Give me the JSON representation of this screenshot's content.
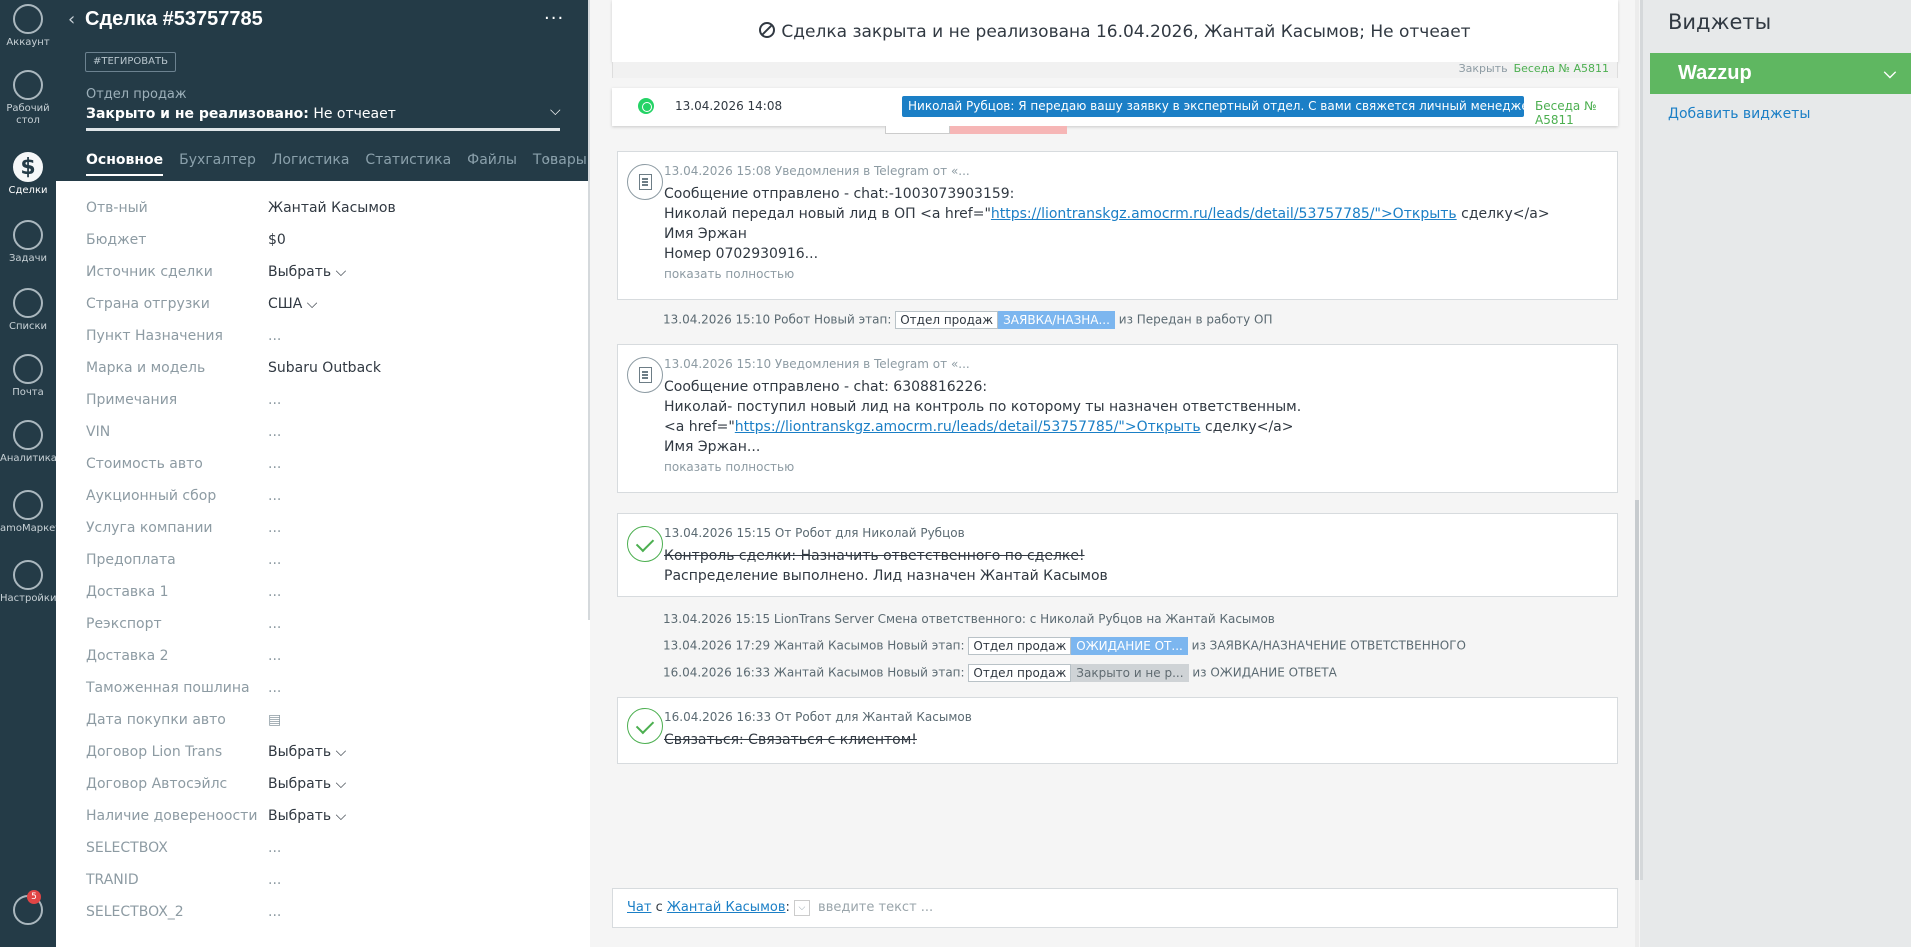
{
  "nav": {
    "items": [
      {
        "label": "Аккаунт",
        "icon": "account-icon"
      },
      {
        "label": "Рабочий стол",
        "icon": "dashboard-icon"
      },
      {
        "label": "Сделки",
        "icon": "deals-icon"
      },
      {
        "label": "Задачи",
        "icon": "tasks-icon"
      },
      {
        "label": "Списки",
        "icon": "lists-icon"
      },
      {
        "label": "Почта",
        "icon": "mail-icon"
      },
      {
        "label": "Аналитика",
        "icon": "analytics-icon"
      },
      {
        "label": "amoМаркет",
        "icon": "market-icon"
      },
      {
        "label": "Настройки",
        "icon": "settings-icon"
      }
    ],
    "notifications_count": "5"
  },
  "card": {
    "title": "Сделка #53757785",
    "tag_button": "#ТЕГИРОВАТЬ",
    "pipeline": "Отдел продаж",
    "status_bold": "Закрыто и не реализовано:",
    "status_reason": "Не отчеает",
    "tabs": [
      "Основное",
      "Бухгалтер",
      "Логистика",
      "Статистика",
      "Файлы",
      "Товары"
    ],
    "tabs_more": "···",
    "fields": [
      {
        "label": "Отв-ный",
        "value": "Жантай Касымов"
      },
      {
        "label": "Бюджет",
        "value": "$0"
      },
      {
        "label": "Источник сделки",
        "value": "Выбрать ⌵"
      },
      {
        "label": "Страна отгрузки",
        "value": "США ⌵"
      },
      {
        "label": "Пункт Назначения",
        "value": "..."
      },
      {
        "label": "Марка и модель",
        "value": "Subaru Outback"
      },
      {
        "label": "Примечания",
        "value": "..."
      },
      {
        "label": "VIN",
        "value": "..."
      },
      {
        "label": "Стоимость авто",
        "value": "..."
      },
      {
        "label": "Аукционный сбор",
        "value": "..."
      },
      {
        "label": "Услуга компании",
        "value": "..."
      },
      {
        "label": "Предоплата",
        "value": "..."
      },
      {
        "label": "Доставка 1",
        "value": "..."
      },
      {
        "label": "Реэкспорт",
        "value": "..."
      },
      {
        "label": "Доставка 2",
        "value": "..."
      },
      {
        "label": "Таможенная пошлина",
        "value": "..."
      },
      {
        "label": "Дата покупки авто",
        "value": "▤"
      },
      {
        "label": "Договор Lion Trans",
        "value": "Выбрать ⌵"
      },
      {
        "label": "Договор Автосэйлс",
        "value": "Выбрать ⌵"
      },
      {
        "label": "Наличие довереноости",
        "value": "Выбрать ⌵"
      },
      {
        "label": "SELECTBOX",
        "value": "..."
      },
      {
        "label": "TRANID",
        "value": "..."
      },
      {
        "label": "SELECTBOX_2",
        "value": "..."
      }
    ]
  },
  "feed": {
    "closed_banner": "Сделка закрыта и не реализована 16.04.2026, Жантай Касымов; Не отчеает",
    "ghost_close": "Закрыть",
    "ghost_conv": "Беседа № A5811",
    "whatsapp": {
      "date": "13.04.2026 14:08",
      "message": "Николай Рубцов: Я передаю вашу заявку в экспертный отдел. С вами свяжется личный менеджер, которы...",
      "conversation": "Беседа № A5811"
    },
    "note1": {
      "meta": "13.04.2026 15:08 Уведомления в Telegram от «...",
      "line1": "Сообщение отправлено - chat:-1003073903159:",
      "line2_pre": "Николай передал новый лид в ОП <a href=\"",
      "line2_link": "https://liontranskgz.amocrm.ru/leads/detail/53757785/\">Открыть",
      "line2_post": " сделку</a>",
      "line3": "Имя Эржан",
      "line4": "Номер 0702930916...",
      "show_full": "показать полностью"
    },
    "sys1": {
      "text": "13.04.2026 15:10 Робот Новый этап:",
      "chip1": "Отдел продаж",
      "chip2": "ЗАЯВКА/НАЗНА...",
      "tail": "из Передан в работу ОП"
    },
    "note2": {
      "meta": "13.04.2026 15:10 Уведомления в Telegram от «...",
      "line1": "Сообщение отправлено - chat: 6308816226:",
      "line2": "Николай- поступил новый лид на контроль по которому ты назначен ответственным.",
      "line3_pre": "<a href=\"",
      "line3_link": "https://liontranskgz.amocrm.ru/leads/detail/53757785/\">Открыть",
      "line3_post": " сделку</a>",
      "line4": "Имя Эржан...",
      "show_full": "показать полностью"
    },
    "task1": {
      "meta": "13.04.2026 15:15  От Робот для Николай Рубцов",
      "line1": "Контроль сделки: Назначить ответственного по сделке!",
      "line2": "Распределение выполнено. Лид назначен Жантай Касымов"
    },
    "sys2": "13.04.2026 15:15 LionTrans Server Смена ответственного: с Николай Рубцов на Жантай Касымов",
    "sys3": {
      "text": "13.04.2026 17:29 Жантай Касымов Новый этап:",
      "chip1": "Отдел продаж",
      "chip2": "ОЖИДАНИЕ ОТ...",
      "tail": "из ЗАЯВКА/НАЗНАЧЕНИЕ ОТВЕТСТВЕННОГО"
    },
    "sys4": {
      "text": "16.04.2026 16:33 Жантай Касымов Новый этап:",
      "chip1": "Отдел продаж",
      "chip2": "Закрыто и не р...",
      "tail": "из ОЖИДАНИЕ ОТВЕТА"
    },
    "task2": {
      "meta": "16.04.2026 16:33  От Робот для Жантай Касымов",
      "line1": "Связаться: Связаться с клиентом!"
    },
    "chat_bar": {
      "chat": "Чат",
      "with": " с ",
      "user": "Жантай Касымов",
      "colon": ":",
      "placeholder": "введите текст ..."
    }
  },
  "widgets": {
    "title": "Виджеты",
    "wazzup": "Wazzup",
    "add": "Добавить виджеты"
  },
  "colors": {
    "nav_bg": "#243b47",
    "wazzup_green": "#5fb761",
    "link_blue": "#1b7fc6",
    "whatsapp_green": "#25d366"
  }
}
